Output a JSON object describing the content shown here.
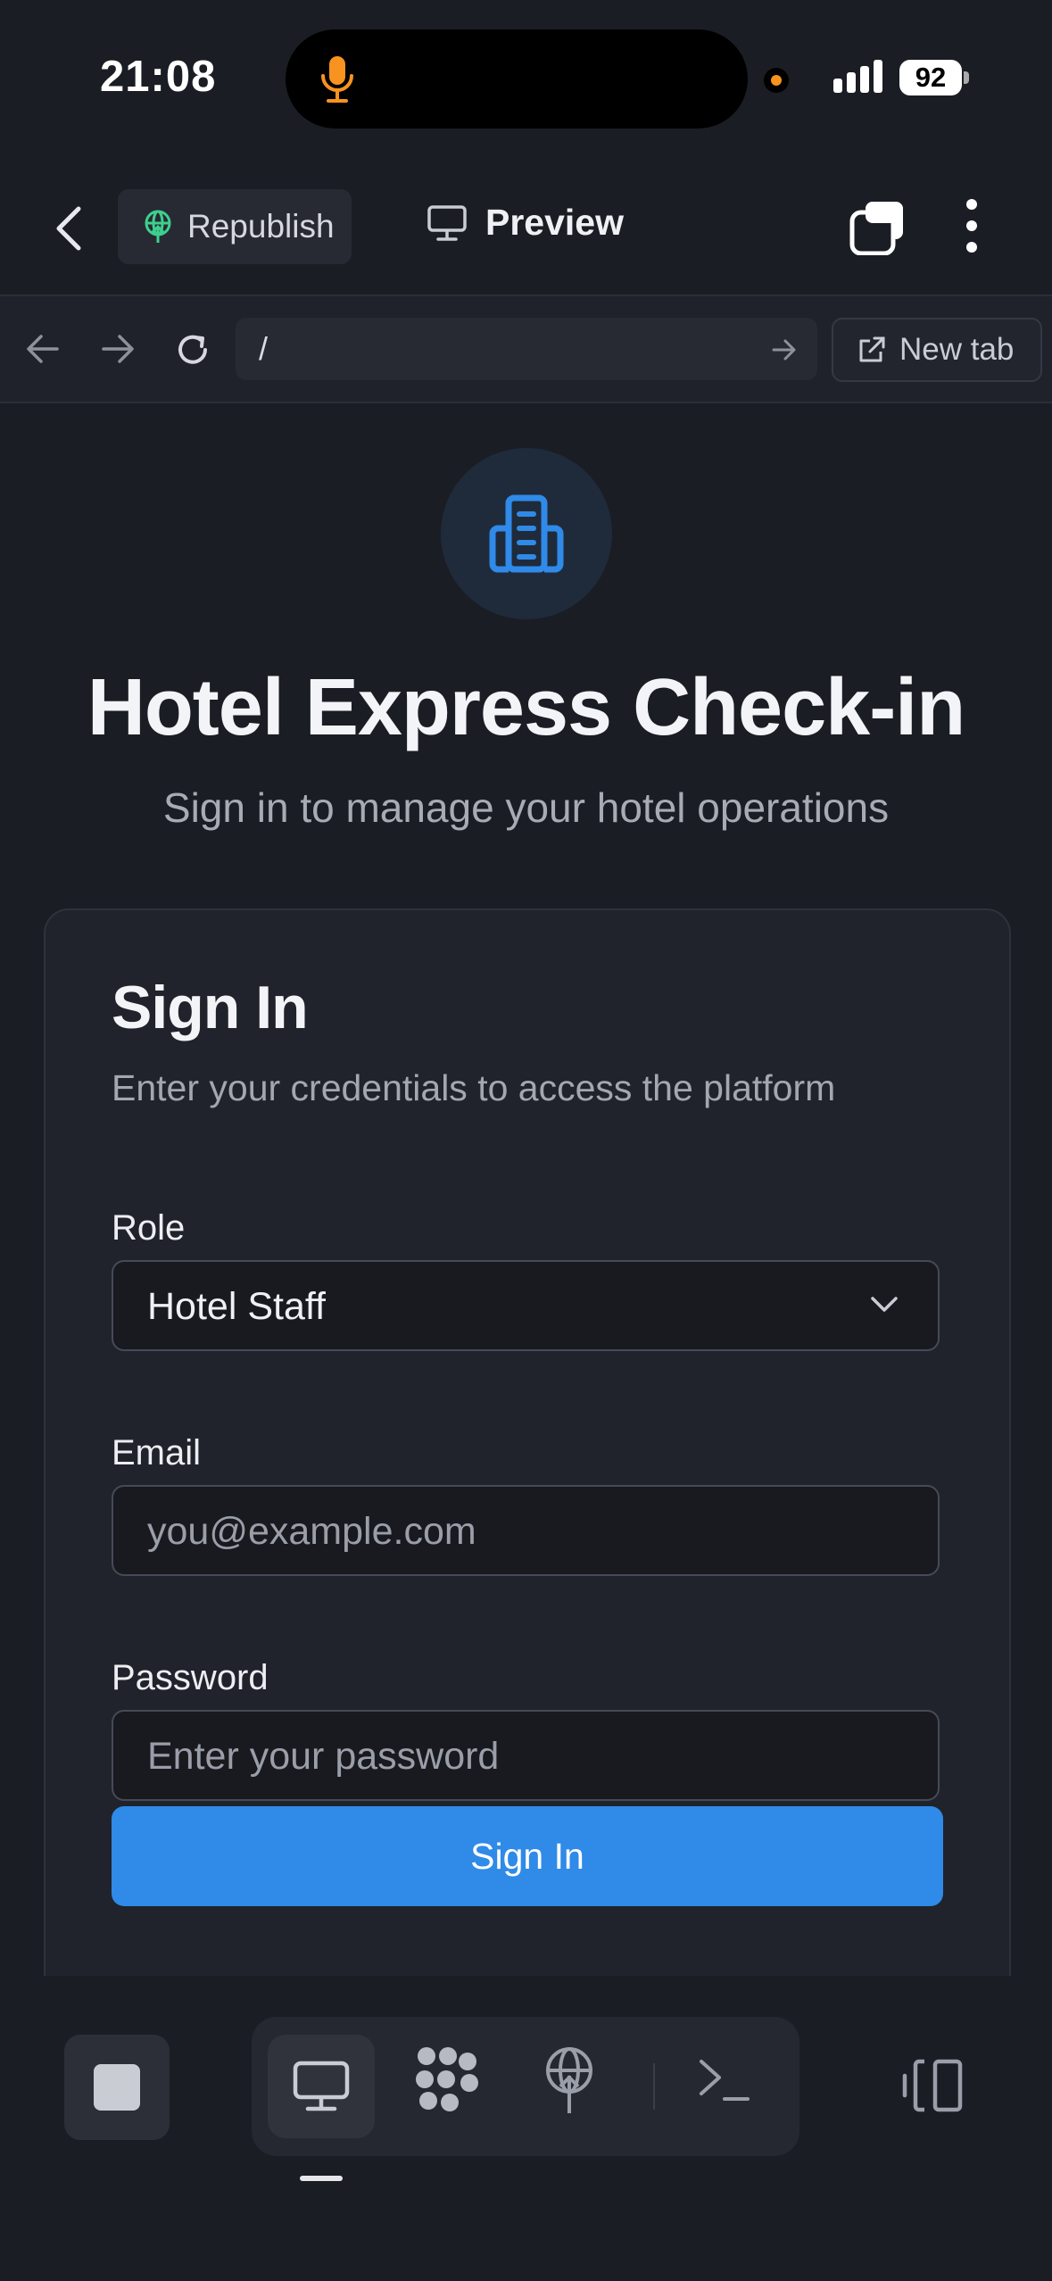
{
  "status_bar": {
    "time": "21:08",
    "battery": "92"
  },
  "toolbar": {
    "republish_label": "Republish",
    "preview_label": "Preview"
  },
  "browser": {
    "url": "/",
    "new_tab_label": "New tab"
  },
  "app": {
    "title": "Hotel Express Check-in",
    "subtitle": "Sign in to manage your hotel operations"
  },
  "signin_card": {
    "title": "Sign In",
    "description": "Enter your credentials to access the platform",
    "role_label": "Role",
    "role_value": "Hotel Staff",
    "email_label": "Email",
    "email_placeholder": "you@example.com",
    "password_label": "Password",
    "password_placeholder": "Enter your password",
    "submit_label": "Sign In"
  },
  "colors": {
    "background": "#1b1d24",
    "card": "#20232b",
    "accent": "#2f8ae8",
    "republish_icon": "#3ecf8e",
    "mic": "#f7931e"
  },
  "icons": {
    "status": [
      "microphone-icon",
      "signal-icon"
    ],
    "toolbar": [
      "back-chevron-icon",
      "republish-icon",
      "monitor-icon",
      "copy-icon",
      "more-vertical-icon"
    ],
    "browser": [
      "arrow-left-icon",
      "arrow-right-icon",
      "reload-icon",
      "go-arrow-icon",
      "external-link-icon"
    ],
    "app": [
      "building-icon",
      "chevron-down-icon"
    ],
    "bottom": [
      "stop-icon",
      "desktop-icon",
      "dots-grid-icon",
      "deploy-icon",
      "terminal-icon",
      "split-view-icon"
    ]
  }
}
